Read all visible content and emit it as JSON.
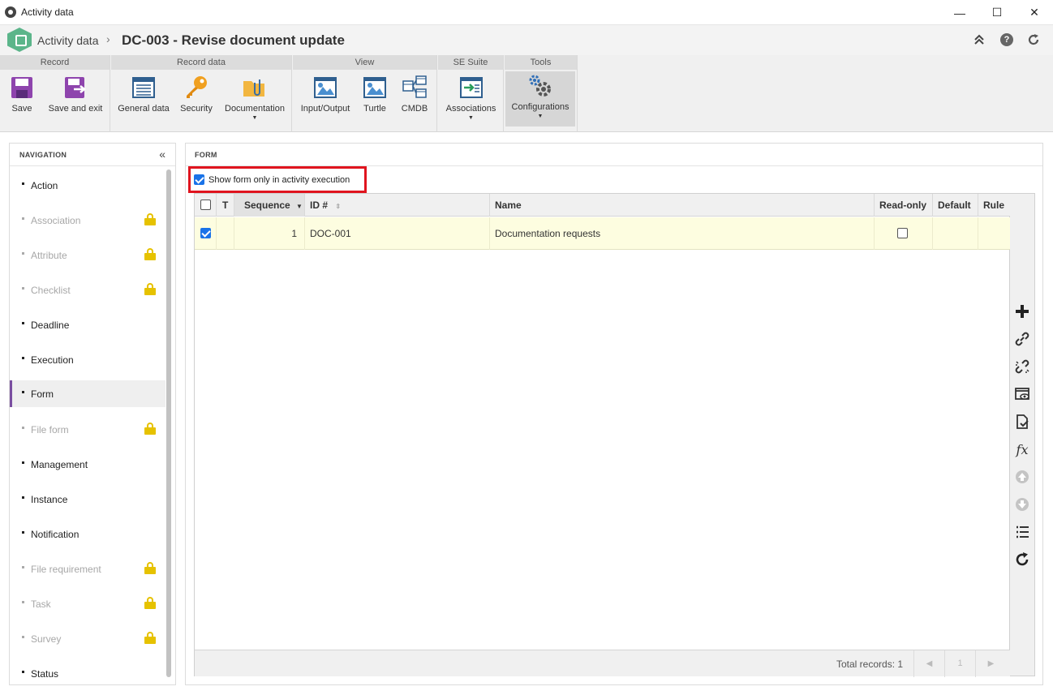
{
  "window": {
    "title": "Activity data",
    "minimize": "—",
    "maximize": "☐",
    "close": "✕"
  },
  "header": {
    "breadcrumb_root": "Activity data",
    "separator": "›",
    "record_title": "DC-003 - Revise document update"
  },
  "ribbon": {
    "groups": [
      {
        "title": "Record"
      },
      {
        "title": "Record data"
      },
      {
        "title": "View"
      },
      {
        "title": "SE Suite"
      },
      {
        "title": "Tools"
      }
    ],
    "buttons": {
      "save": "Save",
      "save_exit": "Save and exit",
      "general": "General data",
      "security": "Security",
      "documentation": "Documentation",
      "input_output": "Input/Output",
      "turtle": "Turtle",
      "cmdb": "CMDB",
      "associations": "Associations",
      "configurations": "Configurations"
    }
  },
  "navigation": {
    "title": "NAVIGATION",
    "items": [
      {
        "label": "Action",
        "locked": false
      },
      {
        "label": "Association",
        "locked": true
      },
      {
        "label": "Attribute",
        "locked": true
      },
      {
        "label": "Checklist",
        "locked": true
      },
      {
        "label": "Deadline",
        "locked": false
      },
      {
        "label": "Execution",
        "locked": false
      },
      {
        "label": "Form",
        "locked": false,
        "active": true
      },
      {
        "label": "File form",
        "locked": true
      },
      {
        "label": "Management",
        "locked": false
      },
      {
        "label": "Instance",
        "locked": false
      },
      {
        "label": "Notification",
        "locked": false
      },
      {
        "label": "File requirement",
        "locked": true
      },
      {
        "label": "Task",
        "locked": true
      },
      {
        "label": "Survey",
        "locked": true
      },
      {
        "label": "Status",
        "locked": false
      }
    ]
  },
  "form": {
    "title": "FORM",
    "show_form_only": {
      "label": "Show form only in activity execution",
      "checked": true
    },
    "grid": {
      "columns": [
        "T",
        "Sequence",
        "ID #",
        "Name",
        "Read-only",
        "Default",
        "Rule"
      ],
      "rows": [
        {
          "selected": true,
          "sequence": "1",
          "id": "DOC-001",
          "name": "Documentation requests",
          "read_only": false
        }
      ],
      "footer": {
        "total": "Total records: 1",
        "page": "1"
      }
    }
  },
  "colors": {
    "accent": "#7a4ea0",
    "checkbox": "#1a73e8",
    "lock": "#e6c200",
    "highlight_box": "#e0141e",
    "row_selected": "#fdfde0"
  }
}
